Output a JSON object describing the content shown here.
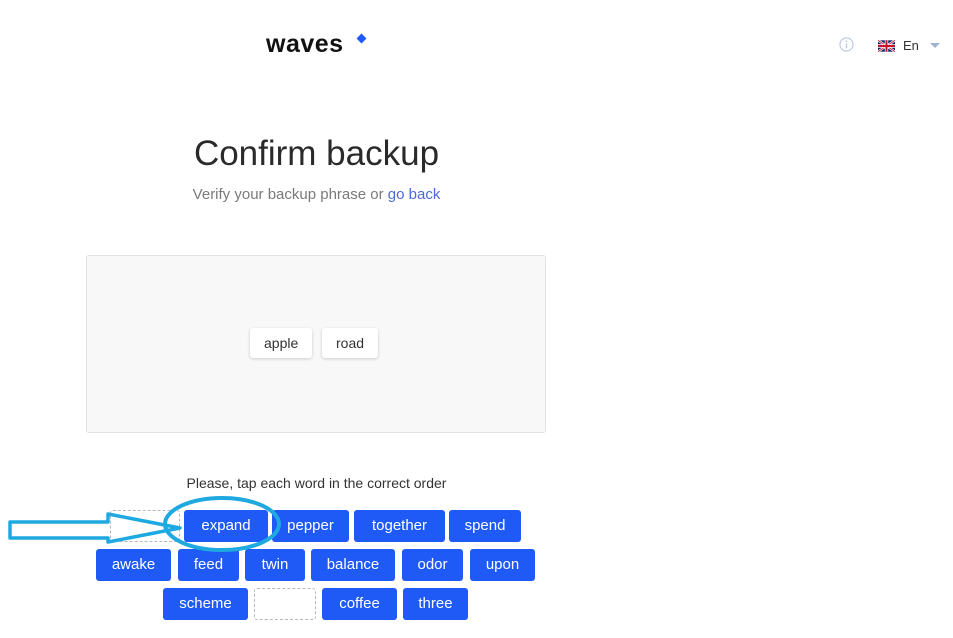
{
  "header": {
    "logo_text": "waves",
    "logo_accent_color": "#1f5af6",
    "info_icon": "info-icon",
    "language": "En",
    "language_flag": "uk-flag-icon"
  },
  "main": {
    "title": "Confirm backup",
    "subtitle_prefix": "Verify your backup phrase or ",
    "go_back_link": "go back",
    "selected_words": [
      "apple",
      "road"
    ],
    "instruction": "Please, tap each word in the correct order",
    "word_rows": [
      [
        "expand",
        "pepper",
        "together",
        "spend"
      ],
      [
        "awake",
        "feed",
        "twin",
        "balance",
        "odor",
        "upon"
      ],
      [
        "scheme",
        "coffee",
        "three"
      ]
    ]
  },
  "colors": {
    "accent": "#1f5af6",
    "annotation": "#1fa9e1",
    "link": "#4a6bd8"
  }
}
